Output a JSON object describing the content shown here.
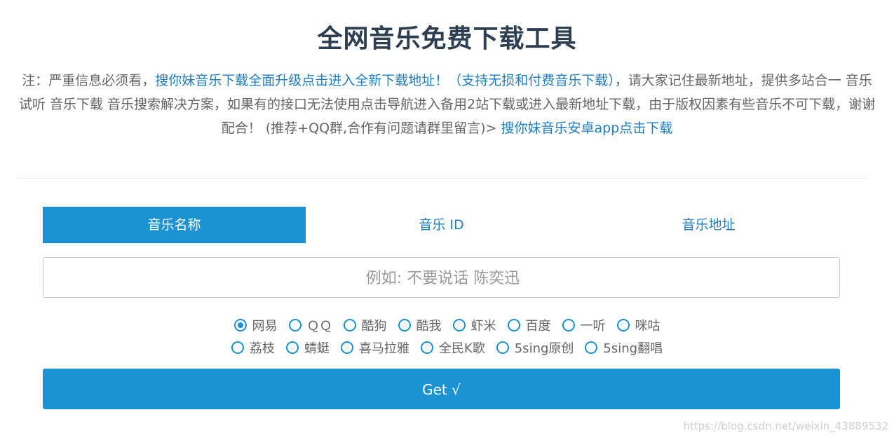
{
  "header": {
    "title": "全网音乐免费下载工具"
  },
  "notice": {
    "prefix": "注：严重信息必须看，",
    "link1": "搜你妹音乐下载全面升级点击进入全新下载地址！（支持无损和付费音乐下载）",
    "middle": "，请大家记住最新地址，提供多站合一 音乐试听 音乐下载 音乐搜索解决方案，如果有的接口无法使用点击导航进入备用2站下载或进入最新地址下载，由于版权因素有些音乐不可下载，谢谢配合！ (推荐+QQ群,合作有问题请群里留言)> ",
    "link2": "搜你妹音乐安卓app点击下载"
  },
  "tabs": [
    {
      "label": "音乐名称",
      "active": true
    },
    {
      "label": "音乐 ID",
      "active": false
    },
    {
      "label": "音乐地址",
      "active": false
    }
  ],
  "search": {
    "placeholder": "例如: 不要说话 陈奕迅",
    "value": ""
  },
  "sources": {
    "row1": [
      "网易",
      "ＱＱ",
      "酷狗",
      "酷我",
      "虾米",
      "百度",
      "一听",
      "咪咕"
    ],
    "row2": [
      "荔枝",
      "蜻蜓",
      "喜马拉雅",
      "全民K歌",
      "5sing原创",
      "5sing翻唱"
    ],
    "selected": "网易"
  },
  "submit": {
    "label": "Get √"
  },
  "watermark": {
    "text": "https://blog.csdn.net/weixin_43889532"
  },
  "colors": {
    "accent": "#1b92d2",
    "link": "#1f7dc2",
    "title": "#2c3e50",
    "text": "#666666"
  }
}
